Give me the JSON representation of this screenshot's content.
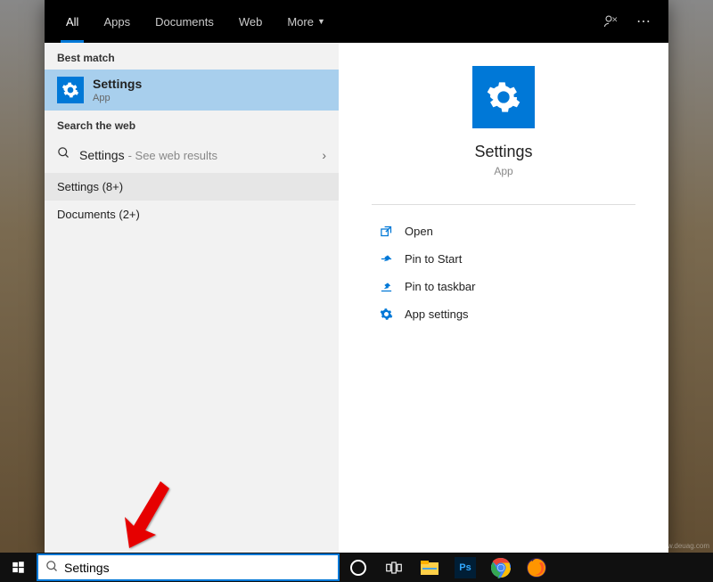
{
  "header": {
    "tabs": [
      "All",
      "Apps",
      "Documents",
      "Web",
      "More"
    ],
    "active_tab_index": 0
  },
  "left": {
    "best_match_header": "Best match",
    "best_match": {
      "title": "Settings",
      "subtitle": "App"
    },
    "web_header": "Search the web",
    "web_row": {
      "label": "Settings",
      "suffix": "- See web results"
    },
    "expandables": [
      {
        "label": "Settings (8+)"
      },
      {
        "label": "Documents (2+)"
      }
    ]
  },
  "detail": {
    "title": "Settings",
    "subtitle": "App",
    "actions": [
      {
        "icon": "open",
        "label": "Open"
      },
      {
        "icon": "pin-start",
        "label": "Pin to Start"
      },
      {
        "icon": "pin-taskbar",
        "label": "Pin to taskbar"
      },
      {
        "icon": "gear",
        "label": "App settings"
      }
    ]
  },
  "search_input": {
    "value": "Settings"
  },
  "taskbar_apps": [
    {
      "name": "file-explorer",
      "bg": "#FFCF48",
      "accent": "#0078d7"
    },
    {
      "name": "photoshop",
      "bg": "#001E36",
      "fg": "#31A8FF",
      "text": "Ps"
    },
    {
      "name": "chrome"
    },
    {
      "name": "firefox"
    }
  ],
  "watermark": "www.deuag.com"
}
